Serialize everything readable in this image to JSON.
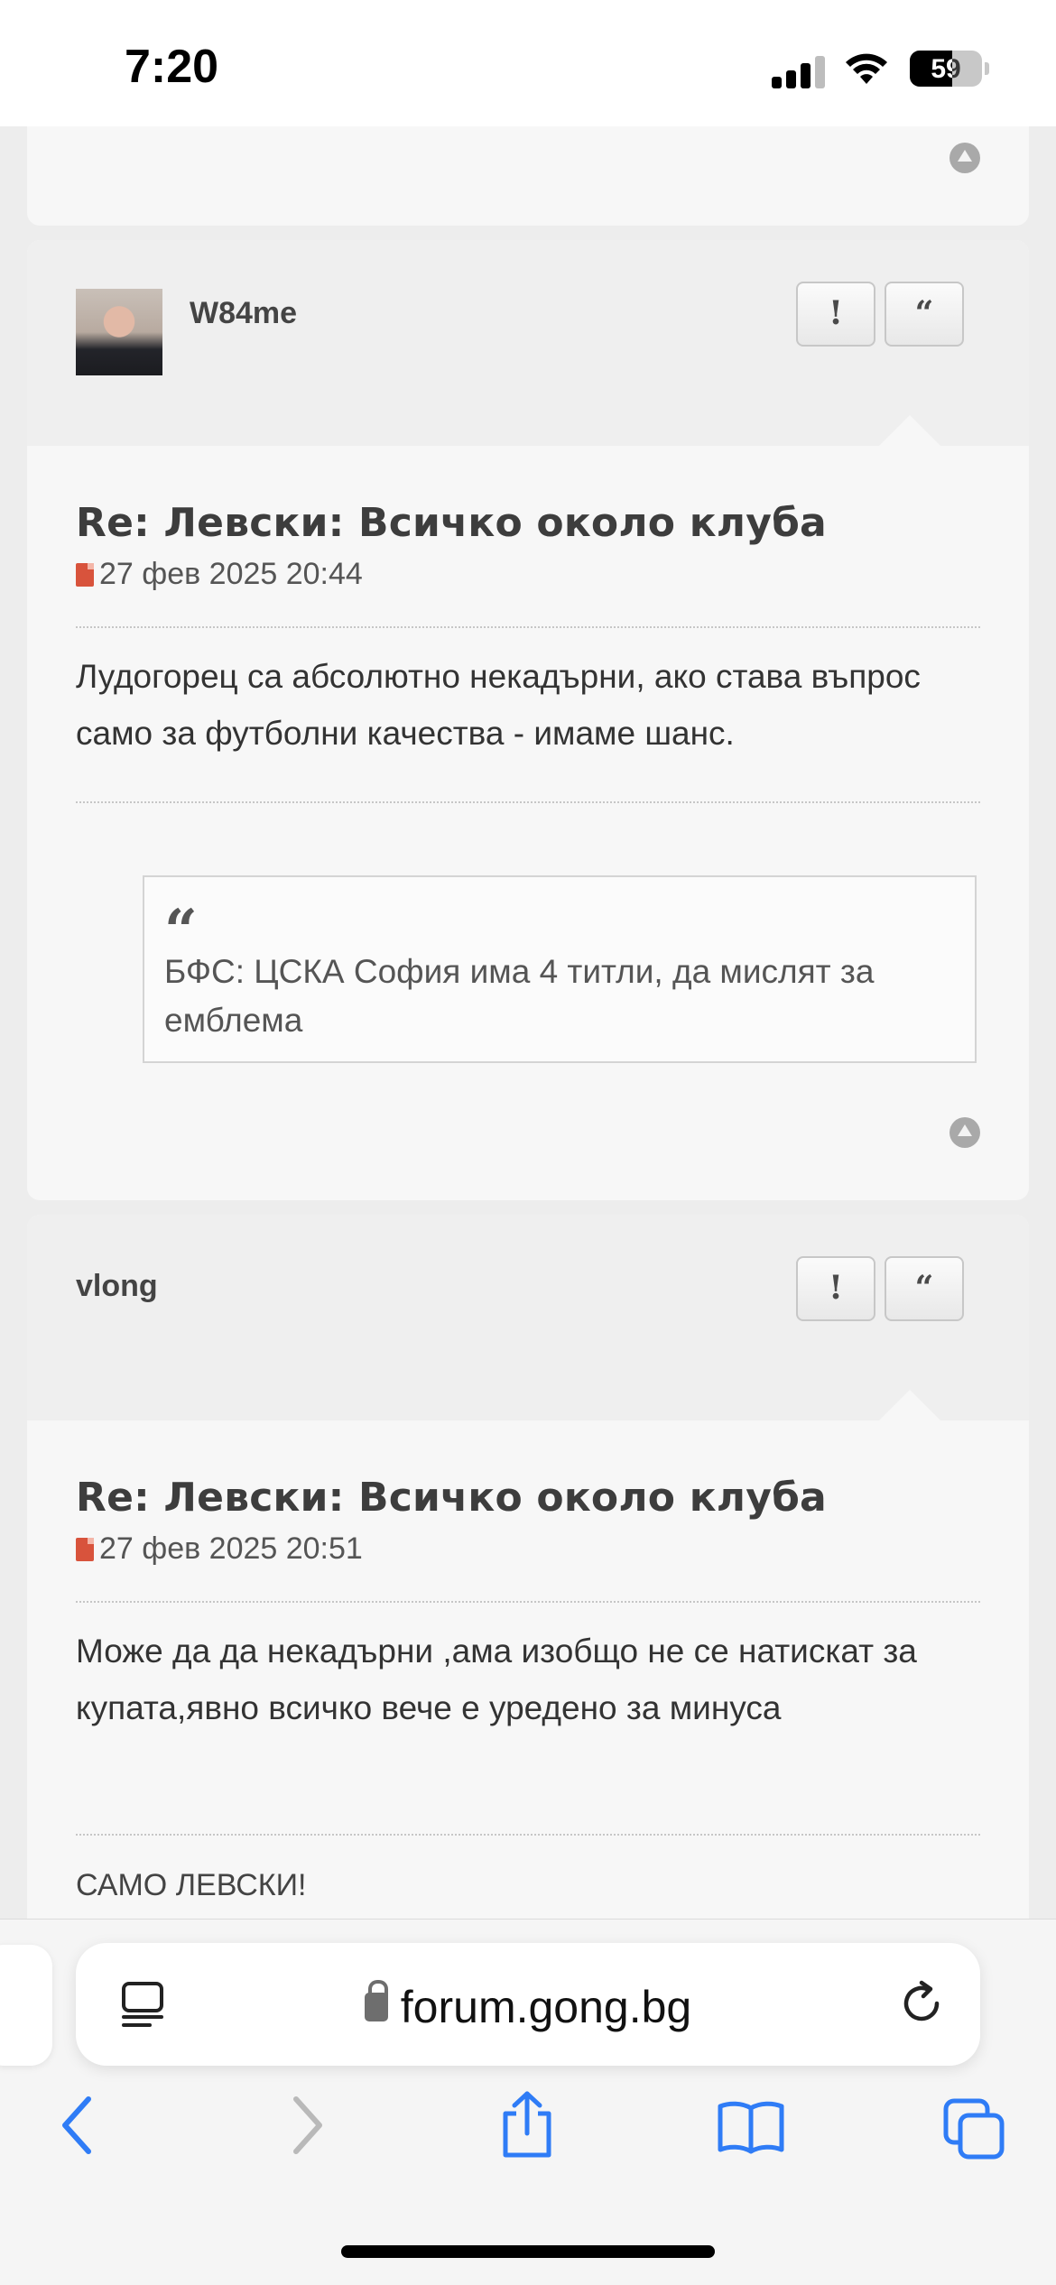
{
  "status_bar": {
    "time": "7:20",
    "battery": "59"
  },
  "posts": [
    {
      "author": "W84me",
      "report_label": "!",
      "quote_label": "“",
      "title": "Re: Левски: Всичко около клуба",
      "date": "27 фев 2025 20:44",
      "text": "Лудогорец са абсолютно некадърни, ако става въпрос само за футболни качества - имаме шанс.",
      "quote_text": "БФС: ЦСКА София има 4 титли, да мислят за емблема"
    },
    {
      "author": "vlong",
      "report_label": "!",
      "quote_label": "“",
      "title": "Re: Левски: Всичко около клуба",
      "date": "27 фев 2025 20:51",
      "text": "Може да да некадърни ,ама изобщо не се натискат за купата,явно всичко вече е уредено за минуса",
      "signature": "САМО ЛЕВСКИ!"
    }
  ],
  "browser": {
    "url": "forum.gong.bg"
  },
  "colors": {
    "accent": "#2f7cf6",
    "panel": "#f7f7f7",
    "header": "#efefef"
  }
}
